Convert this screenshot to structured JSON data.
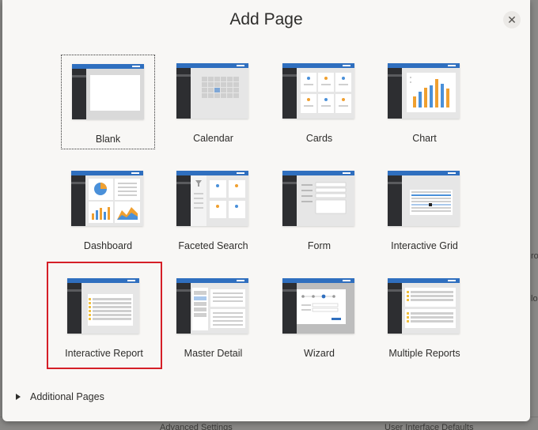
{
  "background": {
    "bottom_left": "Advanced Settings",
    "bottom_right": "User Interface Defaults",
    "edge_right_1": "ro",
    "edge_right_2": "lo"
  },
  "dialog": {
    "title": "Add Page",
    "close_icon": "close-icon",
    "additional_pages_label": "Additional Pages",
    "selected_tile": "Interactive Report",
    "selection_color": "#d51f27",
    "header_color": "#2f6fbf"
  },
  "tiles": [
    {
      "label": "Blank",
      "icon": "blank-template-icon"
    },
    {
      "label": "Calendar",
      "icon": "calendar-template-icon"
    },
    {
      "label": "Cards",
      "icon": "cards-template-icon"
    },
    {
      "label": "Chart",
      "icon": "chart-template-icon"
    },
    {
      "label": "Dashboard",
      "icon": "dashboard-template-icon"
    },
    {
      "label": "Faceted Search",
      "icon": "faceted-search-template-icon"
    },
    {
      "label": "Form",
      "icon": "form-template-icon"
    },
    {
      "label": "Interactive Grid",
      "icon": "interactive-grid-template-icon"
    },
    {
      "label": "Interactive Report",
      "icon": "interactive-report-template-icon"
    },
    {
      "label": "Master Detail",
      "icon": "master-detail-template-icon"
    },
    {
      "label": "Wizard",
      "icon": "wizard-template-icon"
    },
    {
      "label": "Multiple Reports",
      "icon": "multiple-reports-template-icon"
    }
  ]
}
